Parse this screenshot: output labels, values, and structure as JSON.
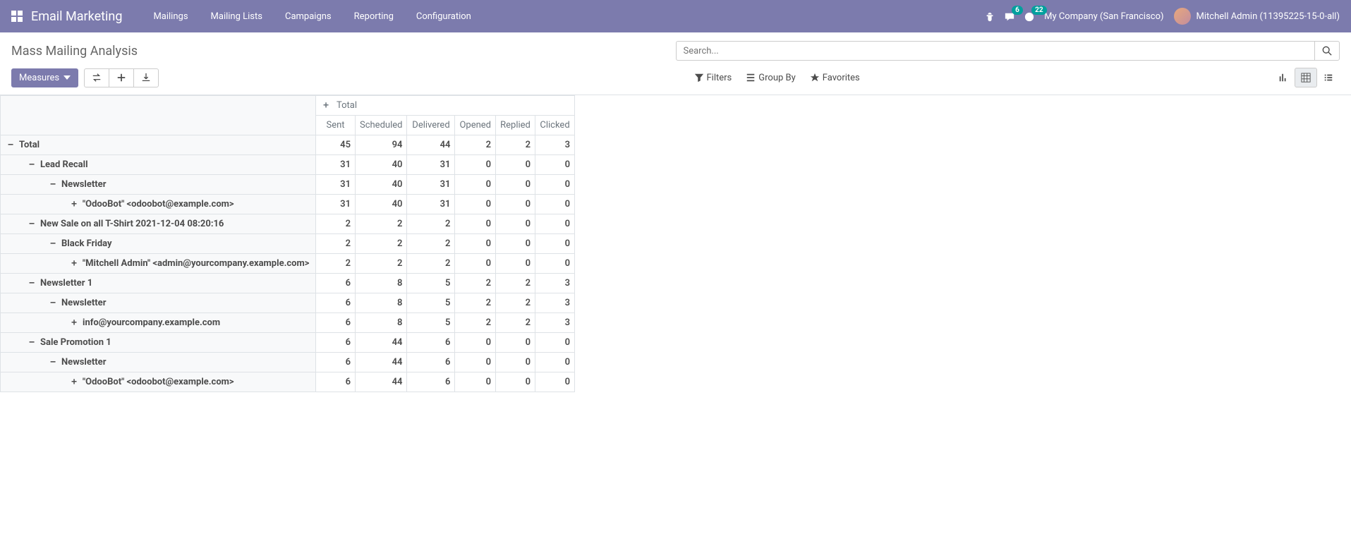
{
  "navbar": {
    "brand": "Email Marketing",
    "menu": [
      "Mailings",
      "Mailing Lists",
      "Campaigns",
      "Reporting",
      "Configuration"
    ],
    "chat_badge": "6",
    "activity_badge": "22",
    "company": "My Company (San Francisco)",
    "user": "Mitchell Admin (11395225-15-0-all)"
  },
  "cp": {
    "title": "Mass Mailing Analysis",
    "search_placeholder": "Search...",
    "measures_label": "Measures",
    "filters": "Filters",
    "groupby": "Group By",
    "favorites": "Favorites"
  },
  "pivot": {
    "total_col_label": "Total",
    "columns": [
      "Sent",
      "Scheduled",
      "Delivered",
      "Opened",
      "Replied",
      "Clicked"
    ],
    "rows": [
      {
        "indent": 0,
        "toggle": "−",
        "label": "Total",
        "values": [
          "45",
          "94",
          "44",
          "2",
          "2",
          "3"
        ]
      },
      {
        "indent": 1,
        "toggle": "−",
        "label": "Lead Recall",
        "values": [
          "31",
          "40",
          "31",
          "0",
          "0",
          "0"
        ]
      },
      {
        "indent": 2,
        "toggle": "−",
        "label": "Newsletter",
        "values": [
          "31",
          "40",
          "31",
          "0",
          "0",
          "0"
        ]
      },
      {
        "indent": 3,
        "toggle": "+",
        "label": "\"OdooBot\" <odoobot@example.com>",
        "values": [
          "31",
          "40",
          "31",
          "0",
          "0",
          "0"
        ]
      },
      {
        "indent": 1,
        "toggle": "−",
        "label": "New Sale on all T-Shirt 2021-12-04 08:20:16",
        "values": [
          "2",
          "2",
          "2",
          "0",
          "0",
          "0"
        ]
      },
      {
        "indent": 2,
        "toggle": "−",
        "label": "Black Friday",
        "values": [
          "2",
          "2",
          "2",
          "0",
          "0",
          "0"
        ]
      },
      {
        "indent": 3,
        "toggle": "+",
        "label": "\"Mitchell Admin\" <admin@yourcompany.example.com>",
        "values": [
          "2",
          "2",
          "2",
          "0",
          "0",
          "0"
        ]
      },
      {
        "indent": 1,
        "toggle": "−",
        "label": "Newsletter 1",
        "values": [
          "6",
          "8",
          "5",
          "2",
          "2",
          "3"
        ]
      },
      {
        "indent": 2,
        "toggle": "−",
        "label": "Newsletter",
        "values": [
          "6",
          "8",
          "5",
          "2",
          "2",
          "3"
        ]
      },
      {
        "indent": 3,
        "toggle": "+",
        "label": "info@yourcompany.example.com",
        "values": [
          "6",
          "8",
          "5",
          "2",
          "2",
          "3"
        ]
      },
      {
        "indent": 1,
        "toggle": "−",
        "label": "Sale Promotion 1",
        "values": [
          "6",
          "44",
          "6",
          "0",
          "0",
          "0"
        ]
      },
      {
        "indent": 2,
        "toggle": "−",
        "label": "Newsletter",
        "values": [
          "6",
          "44",
          "6",
          "0",
          "0",
          "0"
        ]
      },
      {
        "indent": 3,
        "toggle": "+",
        "label": "\"OdooBot\" <odoobot@example.com>",
        "values": [
          "6",
          "44",
          "6",
          "0",
          "0",
          "0"
        ]
      }
    ]
  }
}
